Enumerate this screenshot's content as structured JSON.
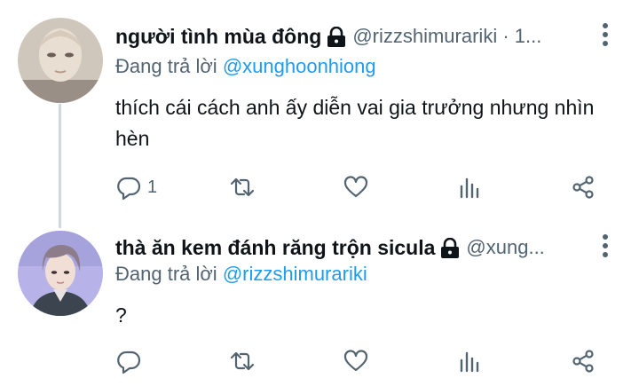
{
  "tweets": [
    {
      "display_name": "người tình mùa đông",
      "handle": "@rizzshimurariki · 1...",
      "replying_prefix": "Đang trả lời",
      "replying_to": "@xunghoonhiong",
      "text": "thích cái cách anh ấy diễn vai gia trưởng nhưng nhìn hèn",
      "reply_count": "1",
      "protected": true
    },
    {
      "display_name": "thà ăn kem đánh răng trộn sicula",
      "handle": "@xung...",
      "replying_prefix": "Đang trả lời",
      "replying_to": "@rizzshimurariki",
      "text": "?",
      "reply_count": "",
      "protected": true
    }
  ],
  "icons": {
    "reply": "reply-icon",
    "retweet": "retweet-icon",
    "like": "like-icon",
    "views": "views-icon",
    "share": "share-icon",
    "more": "more-vertical-icon",
    "lock": "lock-icon"
  },
  "colors": {
    "mention": "#1d9bf0",
    "secondary_text": "#536471",
    "thread_line": "#cfd9de"
  }
}
